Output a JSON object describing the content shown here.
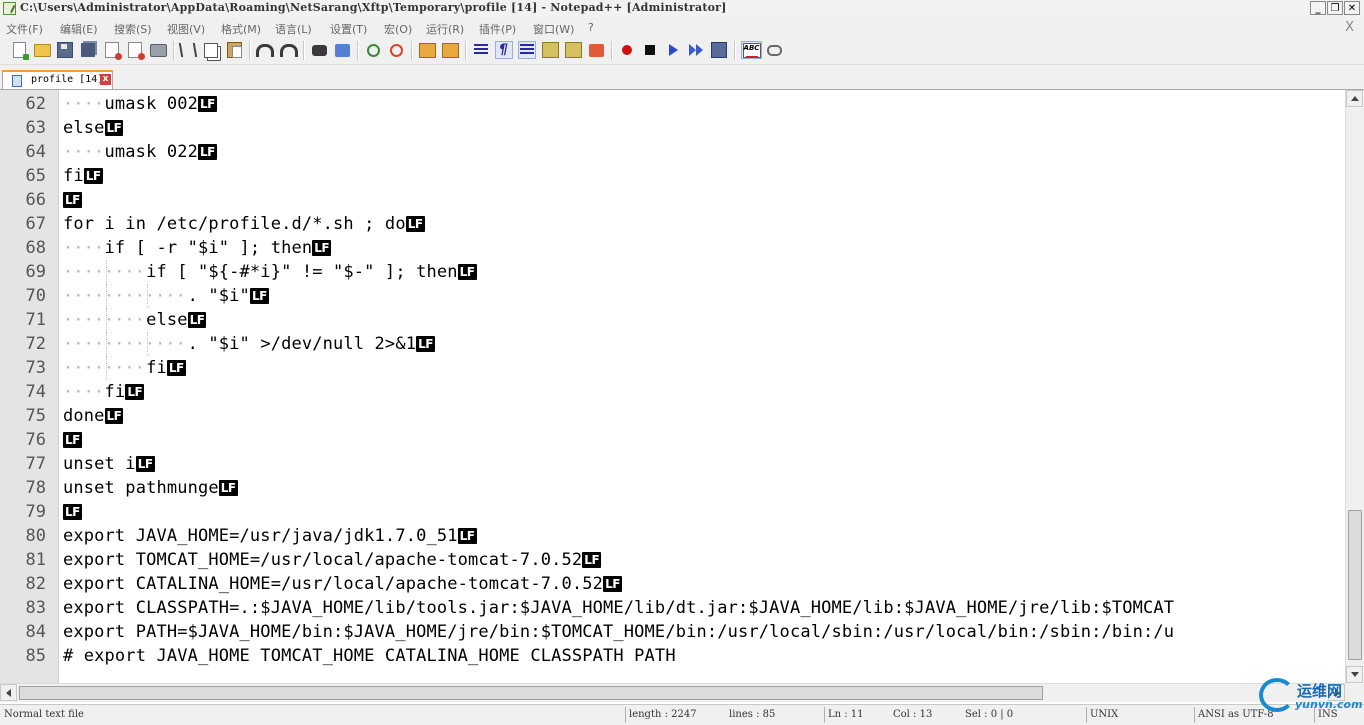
{
  "window": {
    "title": "C:\\Users\\Administrator\\AppData\\Roaming\\NetSarang\\Xftp\\Temporary\\profile [14] - Notepad++ [Administrator]",
    "minimize_label": "_",
    "restore_label": "❐",
    "close_label": "✕"
  },
  "menu": {
    "items": [
      "文件(F)",
      "编辑(E)",
      "搜索(S)",
      "视图(V)",
      "格式(M)",
      "语言(L)",
      "设置(T)",
      "宏(O)",
      "运行(R)",
      "插件(P)",
      "窗口(W)",
      "?"
    ],
    "close_label": "X"
  },
  "toolbar": {
    "icons": [
      "new-file-icon",
      "open-file-icon",
      "save-icon",
      "save-all-icon",
      "close-file-icon",
      "close-all-icon",
      "print-icon",
      "cut-icon",
      "copy-icon",
      "paste-icon",
      "undo-icon",
      "redo-icon",
      "find-icon",
      "replace-icon",
      "zoom-in-icon",
      "zoom-out-icon",
      "sync-vertical-icon",
      "sync-horizontal-icon",
      "word-wrap-icon",
      "show-all-chars-icon",
      "indent-guide-icon",
      "language-icon",
      "folder-as-workspace-icon",
      "record-macro-icon",
      "stop-macro-icon",
      "play-macro-icon",
      "run-macro-multiple-icon",
      "save-macro-icon",
      "spell-check-icon",
      "plugin-icon"
    ],
    "paragraph_glyph": "¶",
    "spell_label": "ABC"
  },
  "tab": {
    "label": "profile [14]",
    "close_label": "x"
  },
  "editor": {
    "eol_marker": "LF",
    "lines": [
      {
        "num": "62",
        "indent": 1,
        "text": "umask 002",
        "eol": true
      },
      {
        "num": "63",
        "indent": 0,
        "text": "else",
        "eol": true
      },
      {
        "num": "64",
        "indent": 1,
        "text": "umask 022",
        "eol": true
      },
      {
        "num": "65",
        "indent": 0,
        "text": "fi",
        "eol": true
      },
      {
        "num": "66",
        "indent": 0,
        "text": "",
        "eol": true
      },
      {
        "num": "67",
        "indent": 0,
        "text": "for i in /etc/profile.d/*.sh ; do",
        "eol": true
      },
      {
        "num": "68",
        "indent": 1,
        "text": "if [ -r \"$i\" ]; then",
        "eol": true
      },
      {
        "num": "69",
        "indent": 2,
        "text": "if [ \"${-#*i}\" != \"$-\" ]; then",
        "eol": true
      },
      {
        "num": "70",
        "indent": 3,
        "text": ". \"$i\"",
        "eol": true
      },
      {
        "num": "71",
        "indent": 2,
        "text": "else",
        "eol": true
      },
      {
        "num": "72",
        "indent": 3,
        "text": ". \"$i\" >/dev/null 2>&1",
        "eol": true
      },
      {
        "num": "73",
        "indent": 2,
        "text": "fi",
        "eol": true
      },
      {
        "num": "74",
        "indent": 1,
        "text": "fi",
        "eol": true
      },
      {
        "num": "75",
        "indent": 0,
        "text": "done",
        "eol": true
      },
      {
        "num": "76",
        "indent": 0,
        "text": "",
        "eol": true
      },
      {
        "num": "77",
        "indent": 0,
        "text": "unset i",
        "eol": true
      },
      {
        "num": "78",
        "indent": 0,
        "text": "unset pathmunge",
        "eol": true
      },
      {
        "num": "79",
        "indent": 0,
        "text": "",
        "eol": true
      },
      {
        "num": "80",
        "indent": 0,
        "text": "export JAVA_HOME=/usr/java/jdk1.7.0_51",
        "eol": true
      },
      {
        "num": "81",
        "indent": 0,
        "text": "export TOMCAT_HOME=/usr/local/apache-tomcat-7.0.52",
        "eol": true
      },
      {
        "num": "82",
        "indent": 0,
        "text": "export CATALINA_HOME=/usr/local/apache-tomcat-7.0.52",
        "eol": true
      },
      {
        "num": "83",
        "indent": 0,
        "text": "export CLASSPATH=.:$JAVA_HOME/lib/tools.jar:$JAVA_HOME/lib/dt.jar:$JAVA_HOME/lib:$JAVA_HOME/jre/lib:$TOMCAT",
        "eol": false
      },
      {
        "num": "84",
        "indent": 0,
        "text": "export PATH=$JAVA_HOME/bin:$JAVA_HOME/jre/bin:$TOMCAT_HOME/bin:/usr/local/sbin:/usr/local/bin:/sbin:/bin:/u",
        "eol": false
      },
      {
        "num": "85",
        "indent": 0,
        "text": "# export JAVA_HOME TOMCAT_HOME CATALINA_HOME CLASSPATH PATH",
        "eol": false
      }
    ]
  },
  "status": {
    "file_type": "Normal text file",
    "length": "length : 2247",
    "lines": "lines : 85",
    "ln": "Ln : 11",
    "col": "Col : 13",
    "sel": "Sel : 0 | 0",
    "eol_format": "UNIX",
    "encoding": "ANSI as UTF-8",
    "insert_mode": "INS"
  },
  "watermark": {
    "text_cn": "运维网",
    "url": "yunvn.com"
  }
}
